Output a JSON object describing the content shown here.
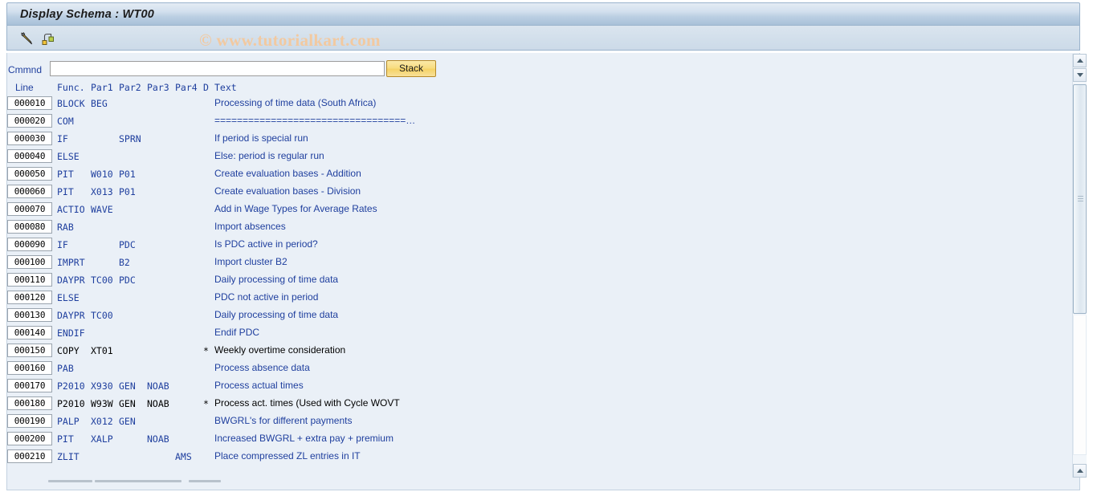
{
  "window": {
    "title": "Display Schema : WT00"
  },
  "toolbar": {
    "icons": [
      {
        "name": "edit-pencil-icon",
        "label": "Change"
      },
      {
        "name": "hierarchy-icon",
        "label": "Structure"
      }
    ]
  },
  "watermark": "© www.tutorialkart.com",
  "command": {
    "label": "Cmmnd",
    "value": "",
    "placeholder": "",
    "stack_button": "Stack"
  },
  "table": {
    "headers": {
      "line": "Line",
      "func": "Func.",
      "par1": "Par1",
      "par2": "Par2",
      "par3": "Par3",
      "par4": "Par4",
      "d": "D",
      "text": "Text"
    },
    "rows": [
      {
        "line": "000010",
        "func": "BLOCK",
        "par1": "BEG",
        "par2": "",
        "par3": "",
        "par4": "",
        "d": "",
        "text": "Processing of time data (South Africa)",
        "black": false
      },
      {
        "line": "000020",
        "func": "COM",
        "par1": "",
        "par2": "",
        "par3": "",
        "par4": "",
        "d": "",
        "text": "==================================…",
        "black": false
      },
      {
        "line": "000030",
        "func": "IF",
        "par1": "",
        "par2": "SPRN",
        "par3": "",
        "par4": "",
        "d": "",
        "text": "If period is special run",
        "black": false
      },
      {
        "line": "000040",
        "func": "ELSE",
        "par1": "",
        "par2": "",
        "par3": "",
        "par4": "",
        "d": "",
        "text": "Else: period is regular run",
        "black": false
      },
      {
        "line": "000050",
        "func": "PIT",
        "par1": "W010",
        "par2": "P01",
        "par3": "",
        "par4": "",
        "d": "",
        "text": "Create evaluation bases - Addition",
        "black": false
      },
      {
        "line": "000060",
        "func": "PIT",
        "par1": "X013",
        "par2": "P01",
        "par3": "",
        "par4": "",
        "d": "",
        "text": "Create evaluation bases - Division",
        "black": false
      },
      {
        "line": "000070",
        "func": "ACTIO",
        "par1": "WAVE",
        "par2": "",
        "par3": "",
        "par4": "",
        "d": "",
        "text": "Add in Wage Types for Average Rates",
        "black": false
      },
      {
        "line": "000080",
        "func": "RAB",
        "par1": "",
        "par2": "",
        "par3": "",
        "par4": "",
        "d": "",
        "text": "Import absences",
        "black": false
      },
      {
        "line": "000090",
        "func": "IF",
        "par1": "",
        "par2": "PDC",
        "par3": "",
        "par4": "",
        "d": "",
        "text": "Is PDC active in period?",
        "black": false
      },
      {
        "line": "000100",
        "func": "IMPRT",
        "par1": "",
        "par2": "B2",
        "par3": "",
        "par4": "",
        "d": "",
        "text": "Import cluster B2",
        "black": false
      },
      {
        "line": "000110",
        "func": "DAYPR",
        "par1": "TC00",
        "par2": "PDC",
        "par3": "",
        "par4": "",
        "d": "",
        "text": "Daily processing of time data",
        "black": false
      },
      {
        "line": "000120",
        "func": "ELSE",
        "par1": "",
        "par2": "",
        "par3": "",
        "par4": "",
        "d": "",
        "text": "PDC not active in period",
        "black": false
      },
      {
        "line": "000130",
        "func": "DAYPR",
        "par1": "TC00",
        "par2": "",
        "par3": "",
        "par4": "",
        "d": "",
        "text": "Daily processing of time data",
        "black": false
      },
      {
        "line": "000140",
        "func": "ENDIF",
        "par1": "",
        "par2": "",
        "par3": "",
        "par4": "",
        "d": "",
        "text": "Endif PDC",
        "black": false
      },
      {
        "line": "000150",
        "func": "COPY",
        "par1": "XT01",
        "par2": "",
        "par3": "",
        "par4": "",
        "d": "*",
        "text": "Weekly overtime consideration",
        "black": true
      },
      {
        "line": "000160",
        "func": "PAB",
        "par1": "",
        "par2": "",
        "par3": "",
        "par4": "",
        "d": "",
        "text": "Process absence data",
        "black": false
      },
      {
        "line": "000170",
        "func": "P2010",
        "par1": "X930",
        "par2": "GEN",
        "par3": "NOAB",
        "par4": "",
        "d": "",
        "text": "Process actual times",
        "black": false
      },
      {
        "line": "000180",
        "func": "P2010",
        "par1": "W93W",
        "par2": "GEN",
        "par3": "NOAB",
        "par4": "",
        "d": "*",
        "text": "Process act. times (Used with Cycle WOVT",
        "black": true
      },
      {
        "line": "000190",
        "func": "PALP",
        "par1": "X012",
        "par2": "GEN",
        "par3": "",
        "par4": "",
        "d": "",
        "text": "BWGRL's for different payments",
        "black": false
      },
      {
        "line": "000200",
        "func": "PIT",
        "par1": "XALP",
        "par2": "",
        "par3": "NOAB",
        "par4": "",
        "d": "",
        "text": "Increased BWGRL + extra pay + premium",
        "black": false
      },
      {
        "line": "000210",
        "func": "ZLIT",
        "par1": "",
        "par2": "",
        "par3": "",
        "par4": "AMS",
        "d": "",
        "text": "Place compressed ZL entries in IT",
        "black": false
      }
    ]
  },
  "scrollbar": {
    "up_arrow": "▲",
    "down_arrow": "▼"
  },
  "colors": {
    "link_blue": "#1f3f9e",
    "title_bar": "#a8c1d9",
    "pane_bg": "#eaf0f7",
    "stack_button": "#f5d267",
    "watermark": "#f2c9a0"
  }
}
